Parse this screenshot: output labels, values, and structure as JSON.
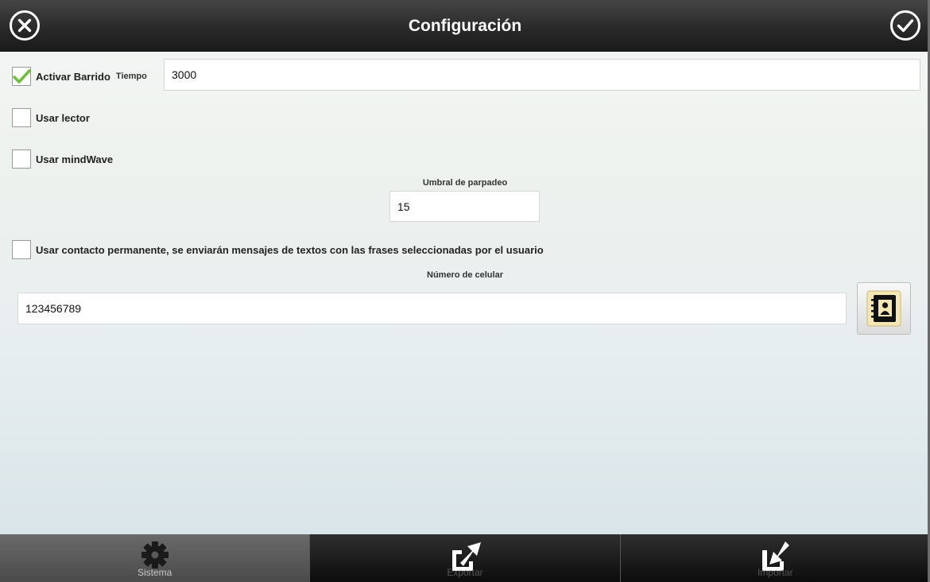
{
  "header": {
    "title": "Configuración",
    "cancel_icon": "close-circle-icon",
    "confirm_icon": "check-circle-icon"
  },
  "scan": {
    "label": "Activar Barrido",
    "checked": true,
    "time_label": "Tiempo",
    "time_value": "3000"
  },
  "reader": {
    "label": "Usar lector",
    "checked": false
  },
  "mindwave": {
    "label": "Usar mindWave",
    "checked": false,
    "threshold_label": "Umbral de parpadeo",
    "threshold_value": "15"
  },
  "contact": {
    "label": "Usar contacto permanente, se enviarán mensajes de textos con las frases seleccionadas por el usuario",
    "checked": false,
    "phone_label": "Número de celular",
    "phone_value": "123456789",
    "contacts_icon": "address-book-icon"
  },
  "tabs": [
    {
      "label": "Sistema",
      "icon": "gear-icon",
      "active": true
    },
    {
      "label": "Exportar",
      "icon": "export-icon",
      "active": false
    },
    {
      "label": "Importar",
      "icon": "import-icon",
      "active": false
    }
  ],
  "colors": {
    "check": "#6bbf3a",
    "contacts_book": "#111111",
    "contacts_card": "#f4e7b4"
  }
}
